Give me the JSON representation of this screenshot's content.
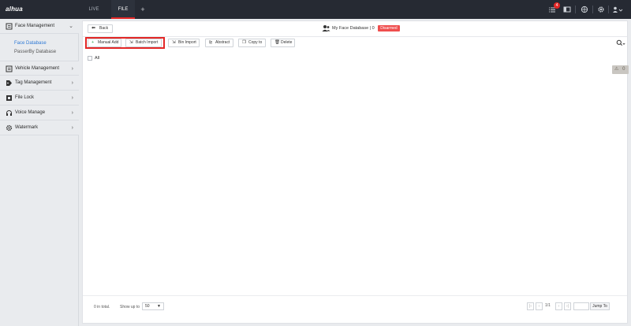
{
  "topbar": {
    "logo": "alhua",
    "tabs": [
      {
        "label": "LIVE"
      },
      {
        "label": "FILE"
      }
    ],
    "add_tab": "+",
    "alarm_count": "4",
    "icons": [
      "alarm-list-icon",
      "display-icon",
      "globe-icon",
      "gear-icon",
      "user-icon"
    ]
  },
  "sidebar": {
    "items": [
      {
        "label": "Face Management",
        "icon": "face-db-icon",
        "chevron": "⌄"
      },
      {
        "label": "Vehicle Management",
        "icon": "vehicle-icon",
        "chevron": "›"
      },
      {
        "label": "Tag Management",
        "icon": "tag-icon",
        "chevron": "›"
      },
      {
        "label": "File Lock",
        "icon": "lock-icon",
        "chevron": "›"
      },
      {
        "label": "Voice Manage",
        "icon": "headset-icon",
        "chevron": "›"
      },
      {
        "label": "Watermark",
        "icon": "gear-icon",
        "chevron": "›"
      }
    ],
    "sub_items": [
      {
        "label": "Face Database",
        "active": true
      },
      {
        "label": "PasserBy Database",
        "active": false
      }
    ]
  },
  "header": {
    "back_label": "Back",
    "db_name": "My Face Database | 0",
    "status": "Disarmed"
  },
  "toolbar": {
    "manual_add": "Manual Add",
    "batch_import": "Batch Import",
    "bin_import": "Bin Import",
    "abstract": "Abstract",
    "copy_to": "Copy to",
    "delete": "Delete"
  },
  "list": {
    "all_label": "All"
  },
  "warn": {
    "count": "0"
  },
  "footer": {
    "total": "0 in total.",
    "show_up_to": "Show up to",
    "page_size": "50",
    "page_info": "1/1",
    "jump_label": "Jump To"
  },
  "colors": {
    "accent": "#e32726",
    "active_link": "#2f7ad5",
    "topbar": "#262a33"
  }
}
